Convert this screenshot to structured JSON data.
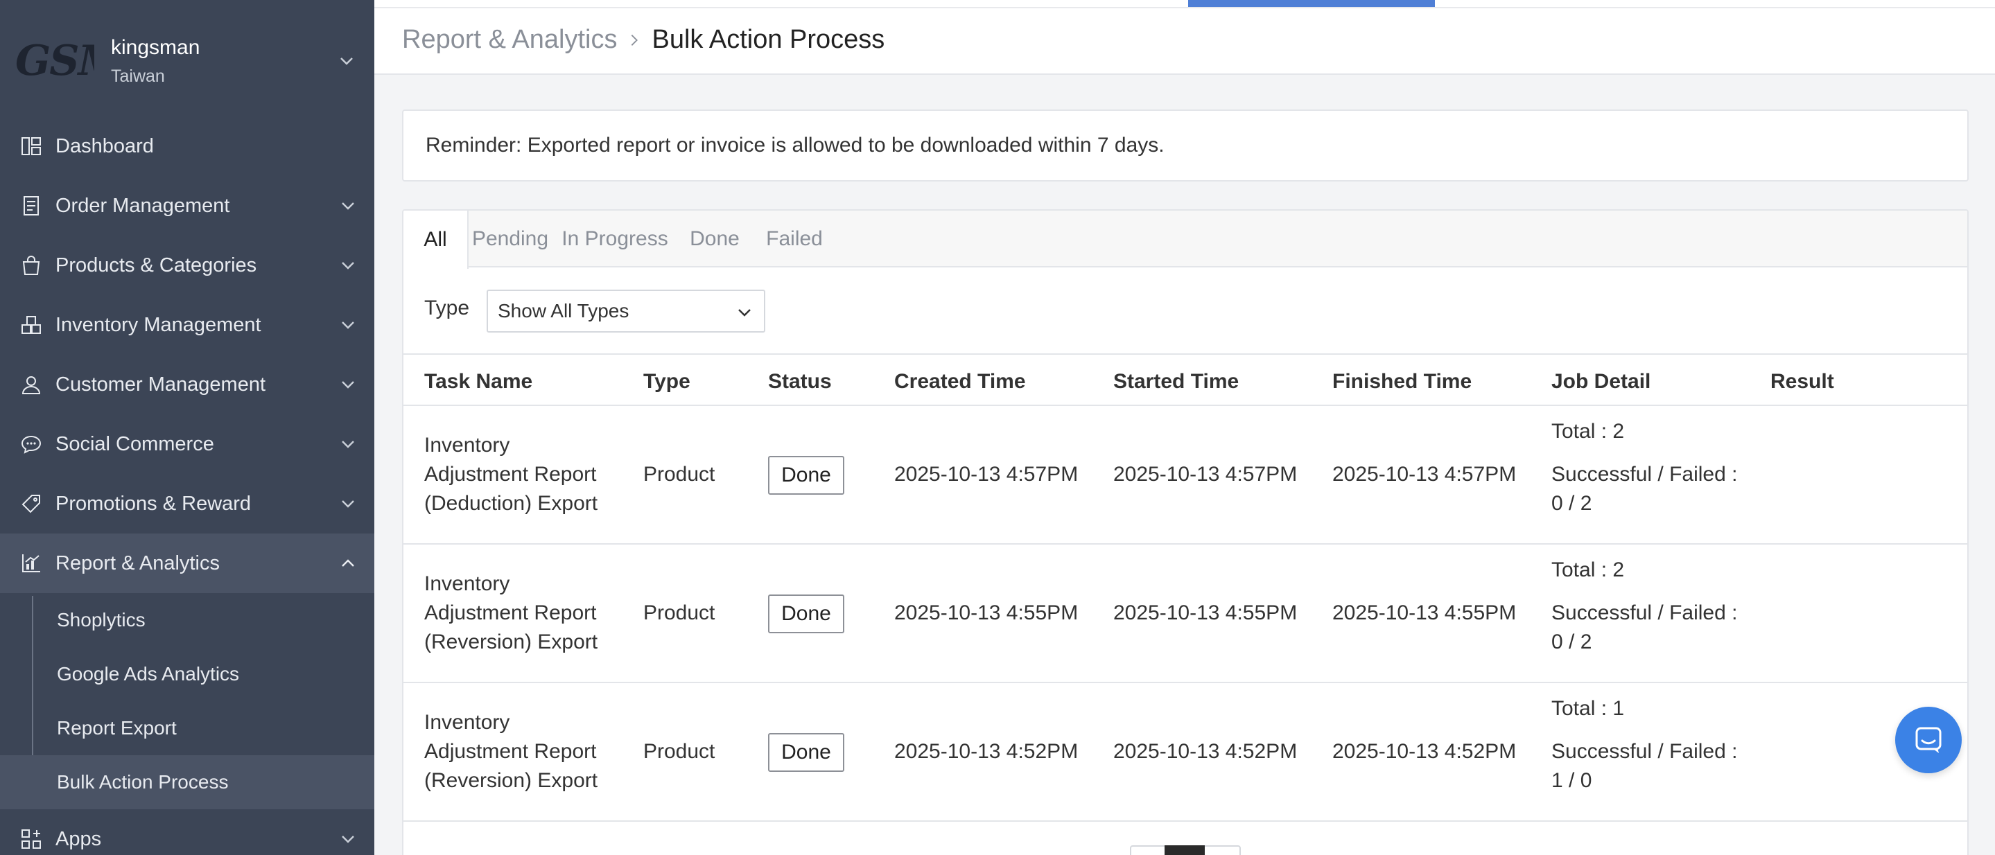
{
  "store": {
    "logo_text": "GSM",
    "name": "kingsman",
    "region": "Taiwan"
  },
  "nav": [
    {
      "label": "Dashboard",
      "icon": "dashboard-icon"
    },
    {
      "label": "Order Management",
      "icon": "order-icon"
    },
    {
      "label": "Products & Categories",
      "icon": "shopping-bag-icon"
    },
    {
      "label": "Inventory Management",
      "icon": "inventory-icon"
    },
    {
      "label": "Customer Management",
      "icon": "user-icon"
    },
    {
      "label": "Social Commerce",
      "icon": "chat-bubble-icon"
    },
    {
      "label": "Promotions & Reward",
      "icon": "tag-icon"
    },
    {
      "label": "Report & Analytics",
      "icon": "chart-icon"
    },
    {
      "label": "Apps",
      "icon": "apps-icon"
    }
  ],
  "subnav": [
    {
      "label": "Shoplytics"
    },
    {
      "label": "Google Ads Analytics"
    },
    {
      "label": "Report Export"
    },
    {
      "label": "Bulk Action Process"
    }
  ],
  "breadcrumb": {
    "parent": "Report & Analytics",
    "current": "Bulk Action Process"
  },
  "reminder": "Reminder: Exported report or invoice is allowed to be downloaded within 7 days.",
  "tabs": [
    "All",
    "Pending",
    "In Progress",
    "Done",
    "Failed"
  ],
  "filter": {
    "label": "Type",
    "value": "Show All Types"
  },
  "table": {
    "headers": [
      "Task Name",
      "Type",
      "Status",
      "Created Time",
      "Started Time",
      "Finished Time",
      "Job Detail",
      "Result"
    ],
    "rows": [
      {
        "task_lines": [
          "Inventory",
          "Adjustment Report",
          "(Deduction) Export"
        ],
        "type": "Product",
        "status": "Done",
        "created": "2025-10-13 4:57PM",
        "started": "2025-10-13 4:57PM",
        "finished": "2025-10-13 4:57PM",
        "total": "Total : 2",
        "success_label": "Successful / Failed :",
        "success_value": "0 / 2",
        "result": ""
      },
      {
        "task_lines": [
          "Inventory",
          "Adjustment Report",
          "(Reversion) Export"
        ],
        "type": "Product",
        "status": "Done",
        "created": "2025-10-13 4:55PM",
        "started": "2025-10-13 4:55PM",
        "finished": "2025-10-13 4:55PM",
        "total": "Total : 2",
        "success_label": "Successful / Failed :",
        "success_value": "0 / 2",
        "result": ""
      },
      {
        "task_lines": [
          "Inventory",
          "Adjustment Report",
          "(Reversion) Export"
        ],
        "type": "Product",
        "status": "Done",
        "created": "2025-10-13 4:52PM",
        "started": "2025-10-13 4:52PM",
        "finished": "2025-10-13 4:52PM",
        "total": "Total : 1",
        "success_label": "Successful / Failed :",
        "success_value": "1 / 0",
        "result": ""
      }
    ]
  },
  "colors": {
    "sidebar": "#3c4556",
    "accent": "#4f7fd6",
    "chat": "#3b82e6"
  }
}
